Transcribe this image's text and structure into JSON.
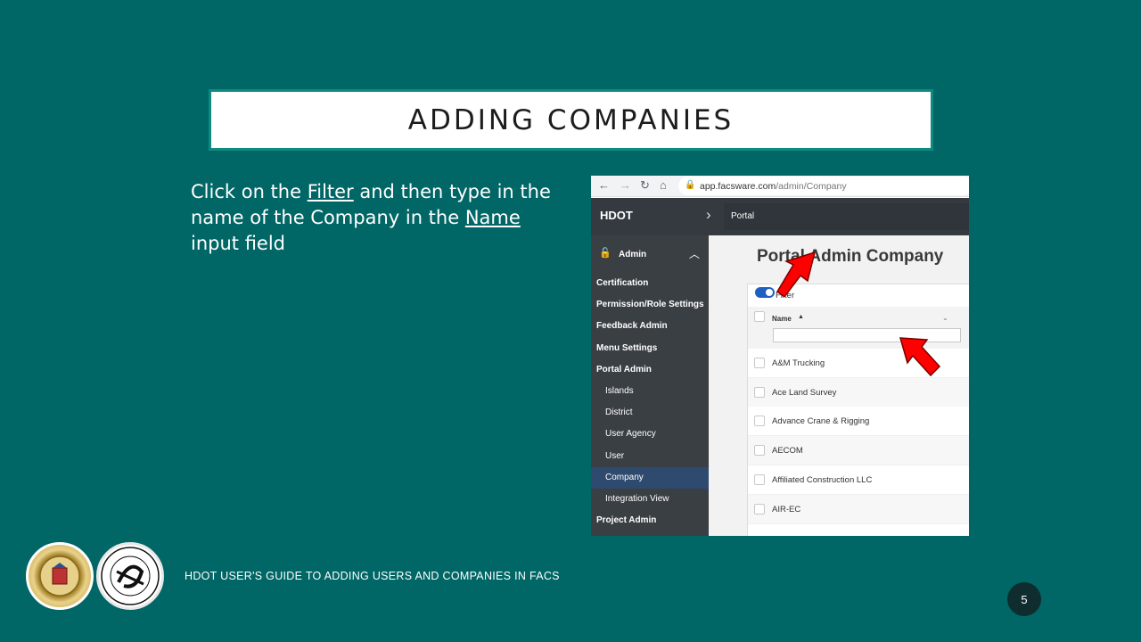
{
  "slide": {
    "title": "ADDING COMPANIES",
    "body": {
      "part1": "Click on the ",
      "link1": "Filter",
      "part2": " and then type in the name of the Company in the ",
      "link2": "Name",
      "part3": " input field"
    },
    "footer": "HDOT USER'S GUIDE TO ADDING USERS AND COMPANIES IN FACS",
    "page_number": "5"
  },
  "browser": {
    "url_host": "app.facsware.com",
    "url_path": "/admin/Company",
    "nav_icons": [
      "back-icon",
      "forward-icon",
      "reload-icon",
      "home-icon",
      "lock-icon"
    ]
  },
  "app": {
    "brand": "HDOT",
    "breadcrumb": "Portal",
    "page_title": "Portal Admin Company",
    "sidebar": {
      "section": "Admin",
      "items": [
        {
          "label": "Certification",
          "sub": false,
          "active": false
        },
        {
          "label": "Permission/Role Settings",
          "sub": false,
          "active": false
        },
        {
          "label": "Feedback Admin",
          "sub": false,
          "active": false
        },
        {
          "label": "Menu Settings",
          "sub": false,
          "active": false
        },
        {
          "label": "Portal Admin",
          "sub": false,
          "active": false
        },
        {
          "label": "Islands",
          "sub": true,
          "active": false
        },
        {
          "label": "District",
          "sub": true,
          "active": false
        },
        {
          "label": "User Agency",
          "sub": true,
          "active": false
        },
        {
          "label": "User",
          "sub": true,
          "active": false
        },
        {
          "label": "Company",
          "sub": true,
          "active": true
        },
        {
          "label": "Integration View",
          "sub": true,
          "active": false
        },
        {
          "label": "Project Admin",
          "sub": false,
          "active": false
        }
      ]
    },
    "grid": {
      "filter_label": "Filter",
      "filter_on": true,
      "column": "Name",
      "name_filter_value": "",
      "rows": [
        "A&M Trucking",
        "Ace Land Survey",
        "Advance Crane & Rigging",
        "AECOM",
        "Affiliated Construction LLC",
        "AIR-EC"
      ]
    }
  },
  "colors": {
    "background": "#006666",
    "title_border": "#0f8a80",
    "annotation_arrow": "#ff0000"
  }
}
